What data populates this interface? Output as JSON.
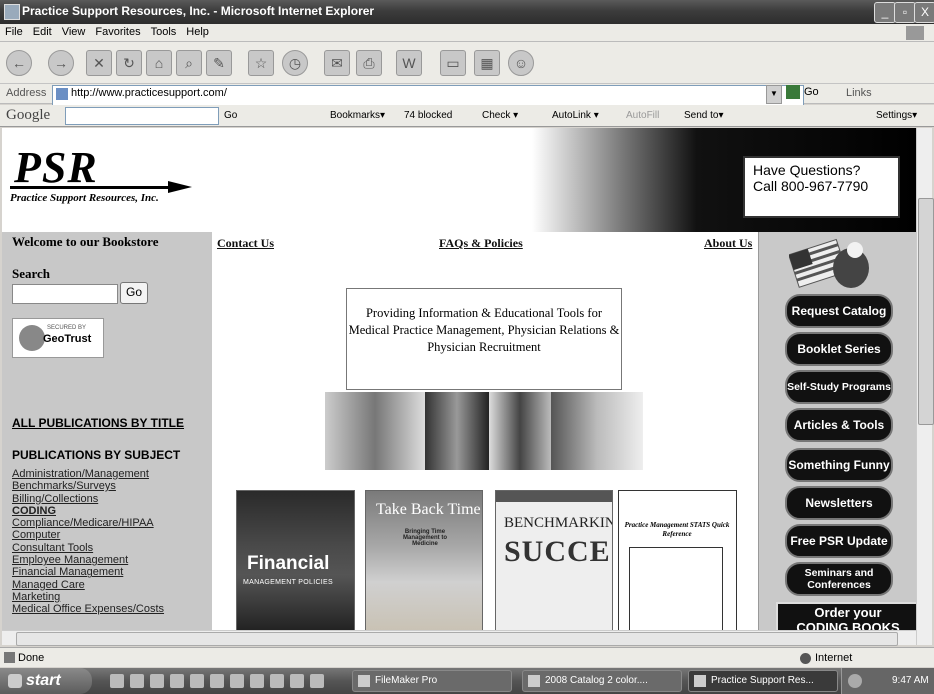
{
  "window": {
    "title": "Practice Support Resources, Inc. - Microsoft Internet Explorer",
    "controls": [
      "_",
      "▫",
      "X"
    ]
  },
  "menu": [
    "File",
    "Edit",
    "View",
    "Favorites",
    "Tools",
    "Help"
  ],
  "address": {
    "label": "Address",
    "url": "http://www.practicesupport.com/",
    "go": "Go",
    "links": "Links"
  },
  "google_bar": {
    "logo": "Google",
    "items": [
      "Go",
      "Bookmarks▾",
      "74 blocked",
      "Check ▾",
      "AutoLink ▾",
      "AutoFill",
      "Send to▾",
      "Settings▾"
    ]
  },
  "header": {
    "logo": "PSR",
    "logo_subtitle": "Practice Support Resources, Inc.",
    "question_title": "Have Questions?",
    "question_call": "Call 800-967-7790"
  },
  "nav": {
    "welcome": "Welcome to our Bookstore",
    "contact": "Contact Us",
    "faqs": "FAQs & Policies",
    "about": "About Us"
  },
  "left": {
    "search_label": "Search",
    "search_button": "Go",
    "geotrust_small": "SECURED BY",
    "geotrust_brand": "GeoTrust",
    "all_publications": "ALL PUBLICATIONS BY TITLE",
    "publications_by_subject": "PUBLICATIONS BY SUBJECT",
    "subjects": [
      "Administration/Management",
      "Benchmarks/Surveys",
      "Billing/Collections",
      "CODING",
      "Compliance/Medicare/HIPAA",
      "Computer",
      "Consultant Tools",
      "Employee Management",
      "Financial Management",
      "Managed Care",
      "Marketing",
      "Medical Office Expenses/Costs"
    ]
  },
  "center": {
    "tagline": "Providing Information & Educational Tools for Medical Practice Management, Physician Relations & Physician Recruitment",
    "books": [
      {
        "title": "Financial",
        "subtitle": "MANAGEMENT POLICIES"
      },
      {
        "title": "Take Back Time",
        "subtitle": "Bringing Time Management to Medicine"
      },
      {
        "title": "BENCHMARKING",
        "subtitle": "SUCCESS"
      },
      {
        "title": "Practice Management STATS Quick Reference"
      }
    ]
  },
  "right": {
    "buttons": [
      "Request Catalog",
      "Booklet Series",
      "Self-Study Programs",
      "Articles & Tools",
      "Something Funny",
      "Newsletters",
      "Free PSR Update",
      "Seminars and Conferences"
    ],
    "order_line1": "Order your",
    "order_line2": "CODING BOOKS"
  },
  "status": {
    "text": "Done",
    "zone": "Internet"
  },
  "taskbar": {
    "start": "start",
    "tasks": [
      "FileMaker Pro",
      "2008 Catalog 2 color....",
      "Practice Support Res..."
    ],
    "clock": "9:47 AM"
  }
}
